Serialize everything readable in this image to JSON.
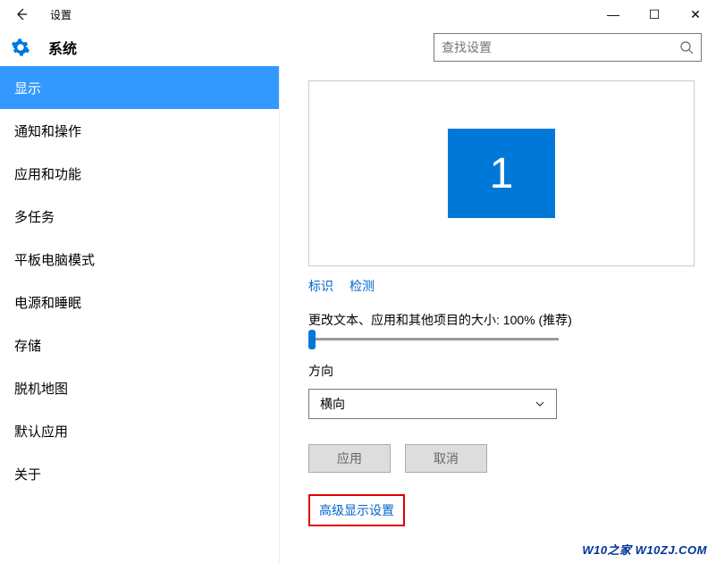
{
  "window": {
    "title": "设置",
    "min": "—",
    "max": "☐",
    "close": "✕"
  },
  "header": {
    "title": "系统"
  },
  "search": {
    "placeholder": "查找设置"
  },
  "sidebar": {
    "items": [
      "显示",
      "通知和操作",
      "应用和功能",
      "多任务",
      "平板电脑模式",
      "电源和睡眠",
      "存储",
      "脱机地图",
      "默认应用",
      "关于"
    ],
    "active_index": 0
  },
  "main": {
    "monitor_number": "1",
    "links": {
      "identify": "标识",
      "detect": "检测"
    },
    "scale_label": "更改文本、应用和其他项目的大小: 100% (推荐)",
    "orientation_label": "方向",
    "orientation_value": "横向",
    "buttons": {
      "apply": "应用",
      "cancel": "取消"
    },
    "advanced": "高级显示设置"
  },
  "watermark": "W10之家 W10ZJ.COM"
}
